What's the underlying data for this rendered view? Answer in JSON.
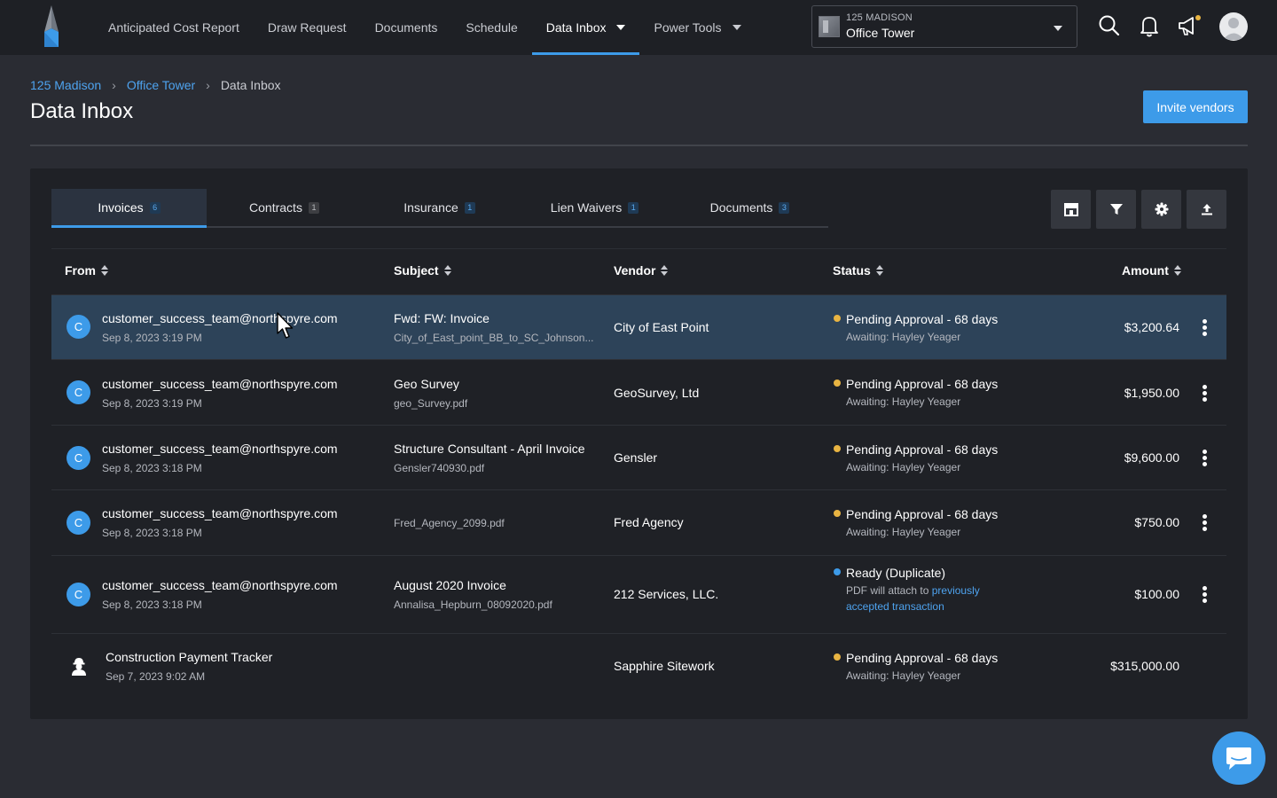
{
  "nav": {
    "items": [
      {
        "label": "Anticipated Cost Report"
      },
      {
        "label": "Draw Request"
      },
      {
        "label": "Documents"
      },
      {
        "label": "Schedule"
      },
      {
        "label": "Data Inbox"
      },
      {
        "label": "Power Tools"
      }
    ],
    "active_index": 4
  },
  "project": {
    "parent": "125 MADISON",
    "name": "Office Tower"
  },
  "breadcrumb": {
    "items": [
      "125 Madison",
      "Office Tower"
    ],
    "current": "Data Inbox"
  },
  "page": {
    "title": "Data Inbox",
    "invite_label": "Invite vendors"
  },
  "tabs": [
    {
      "label": "Invoices",
      "count": "6"
    },
    {
      "label": "Contracts",
      "count": "1"
    },
    {
      "label": "Insurance",
      "count": "1"
    },
    {
      "label": "Lien Waivers",
      "count": "1"
    },
    {
      "label": "Documents",
      "count": "3"
    }
  ],
  "table": {
    "columns": {
      "from": "From",
      "subject": "Subject",
      "vendor": "Vendor",
      "status": "Status",
      "amount": "Amount"
    },
    "rows": [
      {
        "avatar": "C",
        "from": "customer_success_team@northspyre.com",
        "date": "Sep 8, 2023 3:19 PM",
        "subject": "Fwd: FW: Invoice",
        "file": "City_of_East_point_BB_to_SC_Johnson...",
        "vendor": "City of East Point",
        "status": "Pending Approval - 68 days",
        "status_sub": "Awaiting: Hayley Yeager",
        "amount": "$3,200.64"
      },
      {
        "avatar": "C",
        "from": "customer_success_team@northspyre.com",
        "date": "Sep 8, 2023 3:19 PM",
        "subject": "Geo Survey",
        "file": "geo_Survey.pdf",
        "vendor": "GeoSurvey, Ltd",
        "status": "Pending Approval - 68 days",
        "status_sub": "Awaiting: Hayley Yeager",
        "amount": "$1,950.00"
      },
      {
        "avatar": "C",
        "from": "customer_success_team@northspyre.com",
        "date": "Sep 8, 2023 3:18 PM",
        "subject": "Structure Consultant - April Invoice",
        "file": "Gensler740930.pdf",
        "vendor": "Gensler",
        "status": "Pending Approval - 68 days",
        "status_sub": "Awaiting: Hayley Yeager",
        "amount": "$9,600.00"
      },
      {
        "avatar": "C",
        "from": "customer_success_team@northspyre.com",
        "date": "Sep 8, 2023 3:18 PM",
        "subject": "",
        "file": "Fred_Agency_2099.pdf",
        "vendor": "Fred Agency",
        "status": "Pending Approval - 68 days",
        "status_sub": "Awaiting: Hayley Yeager",
        "amount": "$750.00"
      },
      {
        "avatar": "C",
        "from": "customer_success_team@northspyre.com",
        "date": "Sep 8, 2023 3:18 PM",
        "subject": "August 2020 Invoice",
        "file": "Annalisa_Hepburn_08092020.pdf",
        "vendor": "212 Services, LLC.",
        "status": "Ready (Duplicate)",
        "status_sub_prefix": "PDF will attach to",
        "status_link_1": "previously",
        "status_link_2": "accepted transaction",
        "amount": "$100.00"
      },
      {
        "avatar": "",
        "from": "Construction Payment Tracker",
        "date": "Sep 7, 2023 9:02 AM",
        "subject": "",
        "file": "",
        "vendor": "Sapphire Sitework",
        "status": "Pending Approval - 68 days",
        "status_sub": "Awaiting: Hayley Yeager",
        "amount": "$315,000.00"
      }
    ]
  },
  "colors": {
    "accent": "#3d9be9",
    "pending": "#e8b442",
    "ready": "#3d9be9",
    "selected_row": "#2d4359"
  },
  "icons": [
    "search-icon",
    "bell-icon",
    "megaphone-icon",
    "user-avatar-icon",
    "vendor-store-icon",
    "filter-icon",
    "gear-icon",
    "upload-icon",
    "kebab-menu-icon",
    "chat-icon"
  ]
}
